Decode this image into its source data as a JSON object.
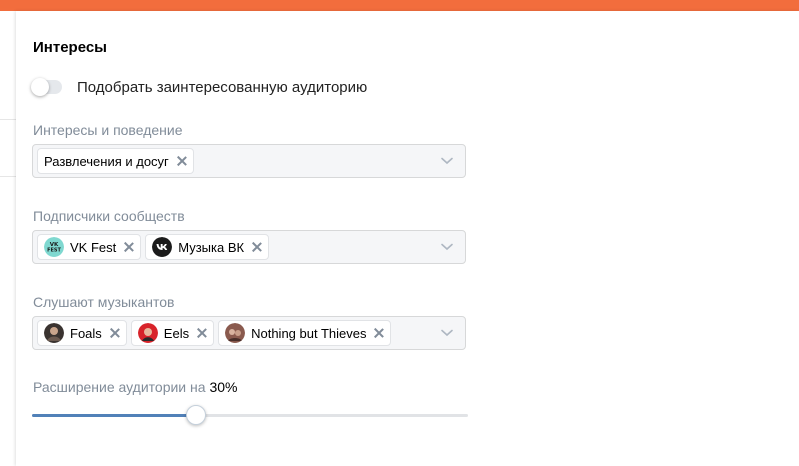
{
  "section": {
    "title": "Интересы"
  },
  "toggle": {
    "label": "Подобрать заинтересованную аудиторию",
    "on": false
  },
  "interests": {
    "label": "Интересы и поведение",
    "chips": [
      {
        "label": "Развлечения и досуг"
      }
    ]
  },
  "communities": {
    "label": "Подписчики сообществ",
    "chips": [
      {
        "label": "VK Fest",
        "icon": "vk-fest-logo-icon",
        "icon_text": "VK\nFEST"
      },
      {
        "label": "Музыка ВК",
        "icon": "vk-music-logo-icon"
      }
    ]
  },
  "musicians": {
    "label": "Слушают музыкантов",
    "chips": [
      {
        "label": "Foals",
        "icon": "foals-avatar-icon"
      },
      {
        "label": "Eels",
        "icon": "eels-avatar-icon"
      },
      {
        "label": "Nothing but Thieves",
        "icon": "nothing-but-thieves-avatar-icon"
      }
    ]
  },
  "expansion": {
    "label": "Расширение аудитории на",
    "value_text": "30%",
    "value": 30,
    "min": 0,
    "max": 80
  },
  "colors": {
    "topbar": "#f26d3d",
    "accent": "#5181b8",
    "muted_text": "#818c99"
  }
}
